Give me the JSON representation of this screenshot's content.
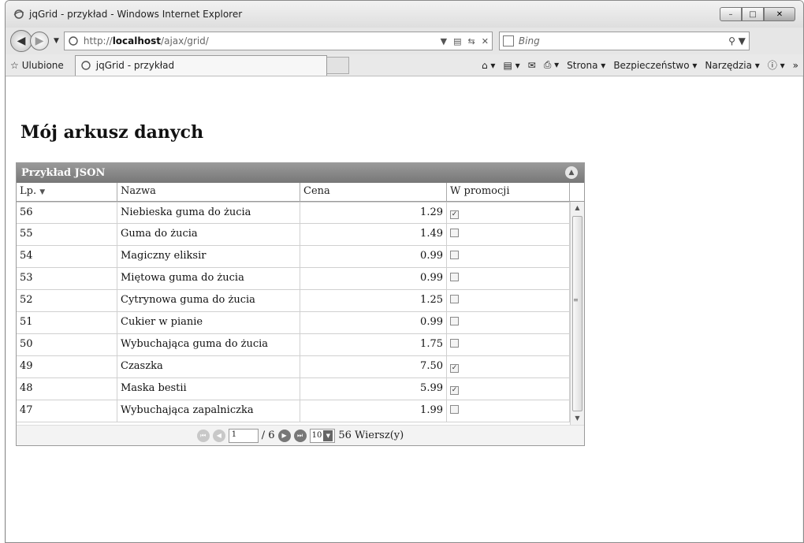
{
  "window": {
    "title": "jqGrid - przykład - Windows Internet Explorer"
  },
  "nav": {
    "url_prefix": "http://",
    "url_host": "localhost",
    "url_path": "/ajax/grid/",
    "search_placeholder": "Bing"
  },
  "favorites": {
    "label": "Ulubione"
  },
  "tab": {
    "title": "jqGrid - przykład"
  },
  "commands": {
    "page": "Strona",
    "safety": "Bezpieczeństwo",
    "tools": "Narzędzia"
  },
  "page": {
    "heading": "Mój arkusz danych"
  },
  "grid": {
    "caption": "Przykład JSON",
    "columns": [
      "Lp.",
      "Nazwa",
      "Cena",
      "W promocji"
    ],
    "rows": [
      {
        "id": "56",
        "name": "Niebieska guma do żucia",
        "price": "1.29",
        "promo": true
      },
      {
        "id": "55",
        "name": "Guma do żucia",
        "price": "1.49",
        "promo": false
      },
      {
        "id": "54",
        "name": "Magiczny eliksir",
        "price": "0.99",
        "promo": false
      },
      {
        "id": "53",
        "name": "Miętowa guma do żucia",
        "price": "0.99",
        "promo": false
      },
      {
        "id": "52",
        "name": "Cytrynowa guma do żucia",
        "price": "1.25",
        "promo": false
      },
      {
        "id": "51",
        "name": "Cukier w pianie",
        "price": "0.99",
        "promo": false
      },
      {
        "id": "50",
        "name": "Wybuchająca guma do żucia",
        "price": "1.75",
        "promo": false
      },
      {
        "id": "49",
        "name": "Czaszka",
        "price": "7.50",
        "promo": true
      },
      {
        "id": "48",
        "name": "Maska bestii",
        "price": "5.99",
        "promo": true
      },
      {
        "id": "47",
        "name": "Wybuchająca zapalniczka",
        "price": "1.99",
        "promo": false
      }
    ],
    "pager": {
      "current_page": "1",
      "total_pages_label": "/ 6",
      "rows_per_page": "10",
      "record_count": "56 Wiersz(y)"
    }
  }
}
